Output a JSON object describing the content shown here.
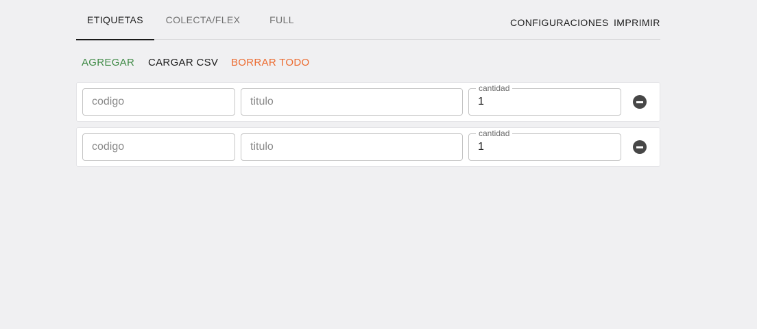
{
  "tabs": [
    {
      "label": "ETIQUETAS",
      "active": true
    },
    {
      "label": "COLECTA/FLEX",
      "active": false
    },
    {
      "label": "FULL",
      "active": false
    }
  ],
  "top_actions": {
    "config_label": "CONFIGURACIONES",
    "print_label": "IMPRIMIR"
  },
  "toolbar": {
    "add_label": "AGREGAR",
    "csv_label": "CARGAR CSV",
    "clear_label": "BORRAR TODO"
  },
  "colors": {
    "add": "#3f8a46",
    "clear": "#ec6a2e",
    "text": "#1a1a1a",
    "background": "#f0f0f2"
  },
  "rows": [
    {
      "codigo": {
        "value": "",
        "placeholder": "codigo"
      },
      "titulo": {
        "value": "",
        "placeholder": "titulo"
      },
      "cantidad": {
        "label": "cantidad",
        "value": "1"
      },
      "remove_icon": "remove-circle-icon"
    },
    {
      "codigo": {
        "value": "",
        "placeholder": "codigo"
      },
      "titulo": {
        "value": "",
        "placeholder": "titulo"
      },
      "cantidad": {
        "label": "cantidad",
        "value": "1"
      },
      "remove_icon": "remove-circle-icon"
    }
  ]
}
